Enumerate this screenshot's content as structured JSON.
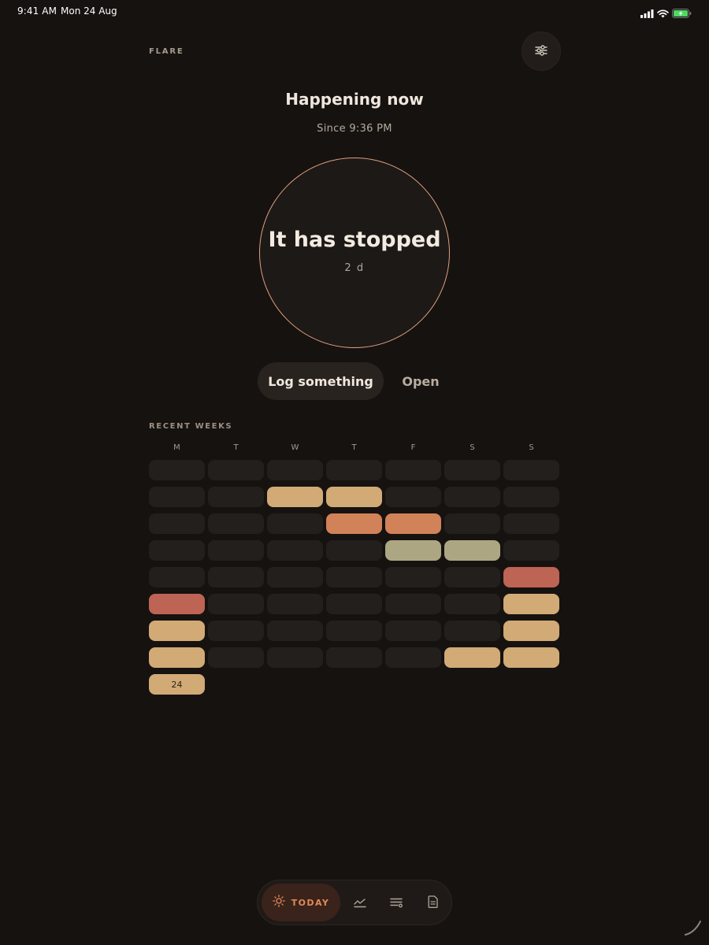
{
  "status_bar": {
    "time": "9:41 AM",
    "date": "Mon 24 Aug"
  },
  "header": {
    "app_name": "FLARE"
  },
  "main": {
    "title": "Happening now",
    "since": "Since 9:36 PM",
    "status_text": "It has stopped",
    "duration": "2 d"
  },
  "actions": {
    "log_label": "Log something",
    "open_label": "Open"
  },
  "recent_weeks": {
    "label": "RECENT WEEKS",
    "days": [
      "M",
      "T",
      "W",
      "T",
      "F",
      "S",
      "S"
    ],
    "palette": {
      "empty": "#231f1c",
      "sand": "#d2aa76",
      "orange": "#d18258",
      "sage": "#aca683",
      "red": "#bd6455"
    },
    "weeks": [
      [
        "empty",
        "empty",
        "empty",
        "empty",
        "empty",
        "empty",
        "empty"
      ],
      [
        "empty",
        "empty",
        "sand",
        "sand",
        "empty",
        "empty",
        "empty"
      ],
      [
        "empty",
        "empty",
        "empty",
        "orange",
        "orange",
        "empty",
        "empty"
      ],
      [
        "empty",
        "empty",
        "empty",
        "empty",
        "sage",
        "sage",
        "empty"
      ],
      [
        "empty",
        "empty",
        "empty",
        "empty",
        "empty",
        "empty",
        "red"
      ],
      [
        "red",
        "empty",
        "empty",
        "empty",
        "empty",
        "empty",
        "sand"
      ],
      [
        "sand",
        "empty",
        "empty",
        "empty",
        "empty",
        "empty",
        "sand"
      ],
      [
        "sand",
        "empty",
        "empty",
        "empty",
        "empty",
        "sand",
        "sand"
      ],
      [
        "sand"
      ]
    ],
    "today_label": "24"
  },
  "tabbar": {
    "today_label": "TODAY"
  }
}
